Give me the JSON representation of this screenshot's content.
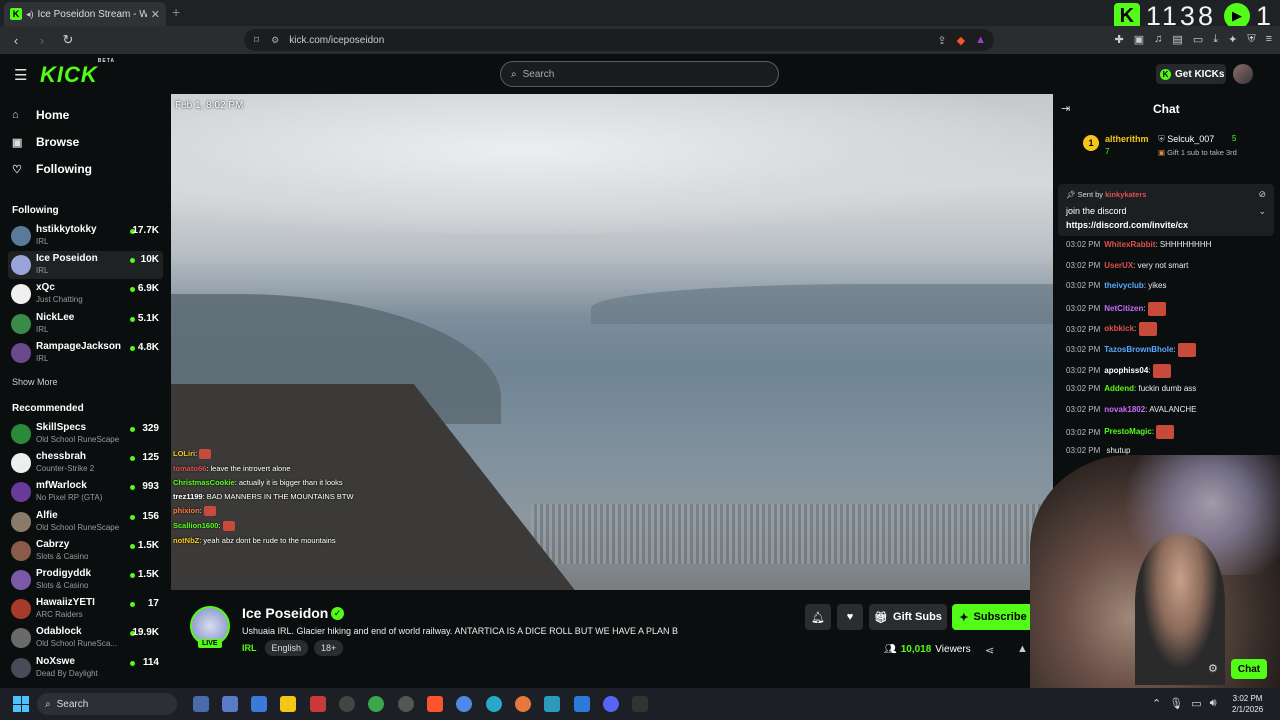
{
  "browser": {
    "tab_title": "Ice Poseidon Stream - Watch",
    "url": "kick.com/iceposeidon",
    "overlay_counter_a": "1138",
    "overlay_counter_b": "1"
  },
  "header": {
    "logo": "KICK",
    "logo_badge": "BETA",
    "search_placeholder": "Search",
    "get_kicks": "Get KICKs"
  },
  "sidebar": {
    "nav": [
      {
        "label": "Home",
        "icon": "home-icon"
      },
      {
        "label": "Browse",
        "icon": "browse-icon"
      },
      {
        "label": "Following",
        "icon": "heart-icon"
      }
    ],
    "following_title": "Following",
    "following": [
      {
        "name": "hstikkytokky",
        "category": "IRL",
        "viewers": "17.7K",
        "color": "#5a7a9a"
      },
      {
        "name": "Ice Poseidon",
        "category": "IRL",
        "viewers": "10K",
        "color": "#9aa4d8"
      },
      {
        "name": "xQc",
        "category": "Just Chatting",
        "viewers": "6.9K",
        "color": "#f0f0f0"
      },
      {
        "name": "NickLee",
        "category": "IRL",
        "viewers": "5.1K",
        "color": "#3a8a4a"
      },
      {
        "name": "RampageJackson",
        "category": "IRL",
        "viewers": "4.8K",
        "color": "#6a4a8a"
      }
    ],
    "show_more": "Show More",
    "recommended_title": "Recommended",
    "recommended": [
      {
        "name": "SkillSpecs",
        "category": "Old School RuneScape",
        "viewers": "329",
        "color": "#2a8a3a"
      },
      {
        "name": "chessbrah",
        "category": "Counter-Strike 2",
        "viewers": "125",
        "color": "#eeeeee"
      },
      {
        "name": "mfWarlock",
        "category": "No Pixel RP (GTA)",
        "viewers": "993",
        "color": "#6a3a9a"
      },
      {
        "name": "Alfie",
        "category": "Old School RuneScape",
        "viewers": "156",
        "color": "#8a7a6a"
      },
      {
        "name": "Cabrzy",
        "category": "Slots & Casino",
        "viewers": "1.5K",
        "color": "#8a5a4a"
      },
      {
        "name": "Prodigyddk",
        "category": "Slots & Casino",
        "viewers": "1.5K",
        "color": "#7a5aa8"
      },
      {
        "name": "HawaiizYETI",
        "category": "ARC Raiders",
        "viewers": "17",
        "color": "#a83a2a"
      },
      {
        "name": "Odablock",
        "category": "Old School RuneSca...",
        "viewers": "19.9K",
        "color": "#6a6a6a"
      },
      {
        "name": "NoXswe",
        "category": "Dead By Daylight",
        "viewers": "114",
        "color": "#4a4a5a"
      }
    ]
  },
  "video": {
    "timestamp": "Feb 1, 8:02 PM",
    "overlay_chat": [
      {
        "user": "LOLiri",
        "text": "",
        "color": "#f5c518"
      },
      {
        "user": "tomato66",
        "text": "leave the introvert alone",
        "color": "#e05050"
      },
      {
        "user": "ChristmasCookie",
        "text": "actually it is bigger than it looks",
        "color": "#53fc18"
      },
      {
        "user": "trez1199",
        "text": "BAD MANNERS IN THE MOUNTAINS BTW",
        "color": "#ffffff"
      },
      {
        "user": "phixion",
        "text": "",
        "color": "#ff7a3a"
      },
      {
        "user": "Scallion1600",
        "text": "",
        "color": "#53fc18"
      },
      {
        "user": "notNbZ",
        "text": "yeah abz dont be rude to the mountains",
        "color": "#f5c518"
      }
    ]
  },
  "stream": {
    "channel": "Ice Poseidon",
    "live": "LIVE",
    "title": "Ushuaia IRL. Glacier hiking and end of world railway. ANTARTICA IS A DICE ROLL BUT WE HAVE A PLAN B",
    "category": "IRL",
    "tags": [
      "English",
      "18+"
    ],
    "gift_subs": "Gift Subs",
    "subscribe": "Subscribe",
    "viewers": "10,018",
    "viewers_label": "Viewers"
  },
  "chat": {
    "title": "Chat",
    "leader_rank": "1",
    "leader_name": "altherithm",
    "leader_count": "7",
    "second_name": "Selcuk_007",
    "second_count": "5",
    "gift_hint": "Gift 1 sub to take 3rd",
    "pinned_by": "Sent by",
    "pinned_user": "kinkykaters",
    "pinned_text": "join the discord",
    "pinned_link": "https://discord.com/invite/cx",
    "messages": [
      {
        "time": "03:02 PM",
        "user": "WhitexRabbit",
        "text": "SHHHHHHHH",
        "color": "#e05050"
      },
      {
        "time": "03:02 PM",
        "user": "UserUX",
        "text": "very not smart",
        "color": "#e05050"
      },
      {
        "time": "03:02 PM",
        "user": "theivyclub",
        "text": "yikes",
        "color": "#5aa8ff"
      },
      {
        "time": "03:02 PM",
        "user": "NetCitizen",
        "text": "",
        "color": "#c86aff"
      },
      {
        "time": "03:02 PM",
        "user": "okbkick",
        "text": "",
        "color": "#e05050"
      },
      {
        "time": "03:02 PM",
        "user": "TazosBrownBhole",
        "text": "",
        "color": "#5aa8ff"
      },
      {
        "time": "03:02 PM",
        "user": "apophiss04",
        "text": "",
        "color": "#ffffff"
      },
      {
        "time": "03:02 PM",
        "user": "Addend",
        "text": "fuckin dumb ass",
        "color": "#53fc18"
      },
      {
        "time": "03:02 PM",
        "user": "novak1802",
        "text": "AVALANCHE",
        "color": "#c86aff"
      },
      {
        "time": "03:02 PM",
        "user": "PrestoMagic",
        "text": "",
        "color": "#53fc18"
      },
      {
        "time": "03:02 PM",
        "user": "",
        "text": "shutup",
        "color": "#ffffff"
      }
    ],
    "send_label": "Chat"
  },
  "taskbar": {
    "search": "Search",
    "time": "3:02 PM",
    "date": "2/1/2026"
  },
  "colors": {
    "accent": "#53fc18",
    "bg": "#0b0e0f"
  }
}
